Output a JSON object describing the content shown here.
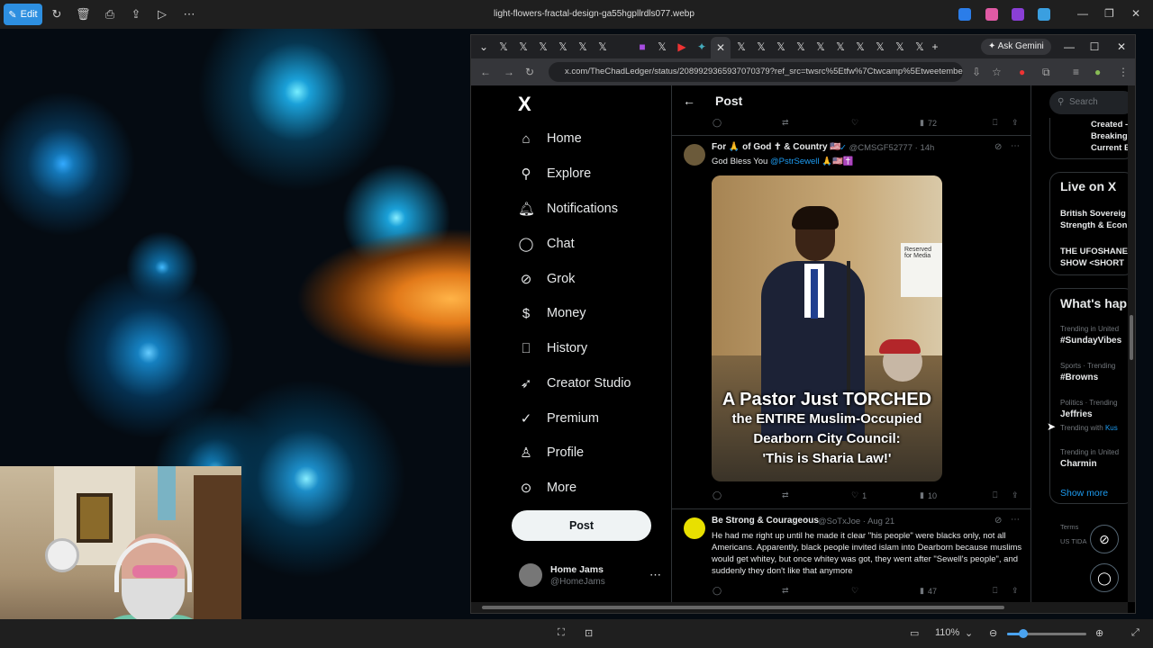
{
  "viewer": {
    "edit_label": "Edit",
    "file_title": "light-flowers-fractal-design-ga55hgpllrdls077.webp",
    "zoom_level": "110%",
    "zoom_fraction": 0.2
  },
  "browser": {
    "ask_gemini": "Ask Gemini",
    "url": "x.com/TheChadLedger/status/2089929365937070379?ref_src=twsrc%5Etfw%7Ctwcamp%5Etweetembed..."
  },
  "x_nav": {
    "logo": "X",
    "items": [
      {
        "label": "Home",
        "icon": "home-icon"
      },
      {
        "label": "Explore",
        "icon": "search-icon"
      },
      {
        "label": "Notifications",
        "icon": "bell-icon"
      },
      {
        "label": "Chat",
        "icon": "chat-icon"
      },
      {
        "label": "Grok",
        "icon": "grok-icon"
      },
      {
        "label": "Money",
        "icon": "money-icon"
      },
      {
        "label": "History",
        "icon": "bookmark-icon"
      },
      {
        "label": "Creator Studio",
        "icon": "rocket-icon"
      },
      {
        "label": "Premium",
        "icon": "premium-icon"
      },
      {
        "label": "Profile",
        "icon": "profile-icon"
      },
      {
        "label": "More",
        "icon": "more-circle-icon"
      }
    ],
    "post_button": "Post",
    "account": {
      "name": "Home Jams",
      "handle": "@HomeJams"
    }
  },
  "post_view": {
    "title": "Post",
    "top_actions": {
      "views": "72"
    },
    "tweets": [
      {
        "name": "For 🙏 of God ✝ & Country 🇺🇸",
        "handle": "@CMSGF52777",
        "time": "14h",
        "text_prefix": "God Bless You ",
        "mention": "@PstrSewell",
        "text_suffix": " 🙏🇺🇸✝️",
        "media_caption_1": "A Pastor Just TORCHED",
        "media_caption_2": "the ENTIRE Muslim-Occupied",
        "media_caption_3": "Dearborn City Council:",
        "media_caption_4": "'This is Sharia Law!'",
        "media_sign": "Reserved for Media",
        "likes": "1",
        "views": "10"
      },
      {
        "name": "Be Strong & Courageous",
        "handle": "@SoTxJoe",
        "time": "Aug 21",
        "text": "He had me right up until he made it clear \"his people\" were blacks only, not all Americans. Apparently, black people invited islam into Dearborn because muslims would get whitey, but once whitey was got, they went after \"Sewell's people\", and suddenly they don't like that anymore",
        "views": "47"
      }
    ]
  },
  "sidebar": {
    "search_placeholder": "Search",
    "news_lines": [
      "Created -",
      "Breaking",
      "Current E"
    ],
    "live": {
      "title": "Live on X",
      "items": [
        {
          "line1": "British Sovereig",
          "line2": "Strength & Econ"
        },
        {
          "line1": "THE UFOSHANE",
          "line2": "SHOW <SHORT"
        }
      ]
    },
    "trends": {
      "title": "What's hap",
      "items": [
        {
          "meta": "Trending in United",
          "tag": "#SundayVibes"
        },
        {
          "meta": "Sports · Trending",
          "tag": "#Browns"
        },
        {
          "meta": "Politics · Trending",
          "tag": "Jeffries",
          "sub": "Trending with",
          "sub_link": "Kus"
        },
        {
          "meta": "Trending in United",
          "tag": "Charmin"
        }
      ],
      "show_more": "Show more"
    },
    "footer": [
      "Terms",
      "US TIDA"
    ]
  }
}
